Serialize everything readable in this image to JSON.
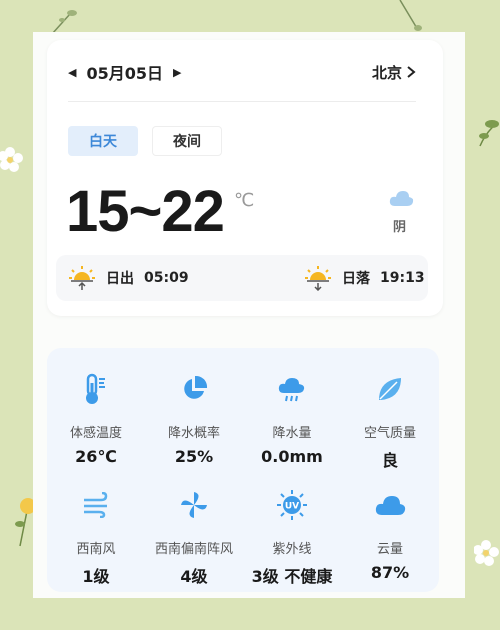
{
  "header": {
    "prev_icon": "triangle-left-icon",
    "date": "05月05日",
    "next_icon": "triangle-right-icon",
    "city": "北京",
    "city_icon": "chevron-right-icon"
  },
  "tabs": [
    {
      "label": "白天",
      "active": true
    },
    {
      "label": "夜间",
      "active": false
    }
  ],
  "forecast": {
    "temp_range": "15~22",
    "unit": "℃",
    "condition": "阴",
    "condition_icon": "cloud-icon"
  },
  "sun": {
    "sunrise_label": "日出",
    "sunrise_time": "05:09",
    "sunset_label": "日落",
    "sunset_time": "19:13"
  },
  "details": [
    {
      "icon": "thermometer-icon",
      "label": "体感温度",
      "value": "26℃"
    },
    {
      "icon": "pie-chart-icon",
      "label": "降水概率",
      "value": "25%"
    },
    {
      "icon": "rain-cloud-icon",
      "label": "降水量",
      "value": "0.0mm"
    },
    {
      "icon": "leaf-icon",
      "label": "空气质量",
      "value": "良"
    },
    {
      "icon": "wind-icon",
      "label": "西南风",
      "value": "1级"
    },
    {
      "icon": "pinwheel-icon",
      "label": "西南偏南阵风",
      "value": "4级"
    },
    {
      "icon": "uv-icon",
      "label": "紫外线",
      "value": "3级 不健康"
    },
    {
      "icon": "cloud-icon",
      "label": "云量",
      "value": "87%"
    }
  ],
  "colors": {
    "background": "#dbe4b8",
    "accent": "#3d88d8",
    "active_tab_bg": "#e3eefb",
    "sun_yellow": "#f5b621",
    "icon_blue": "#3d9be9"
  }
}
